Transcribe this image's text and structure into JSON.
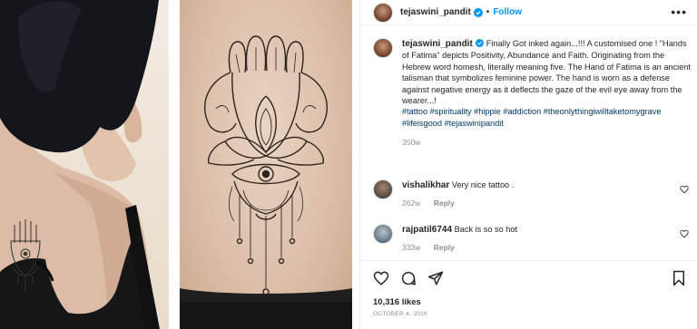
{
  "post": {
    "username": "tejaswini_pandit",
    "separator": "•",
    "follow_label": "Follow",
    "more_label": "•••",
    "caption": "Finally Got inked again...!!! A customised one ! \"Hands of Fatima\" depicts Positivity, Abundance and Faith. Originating from the Hebrew word homesh, literally meaning five. The Hand of Fatima is an ancient talisman that symbolizes feminine power. The hand is worn as a defense against negative energy as it deflects the gaze of the evil eye away from the wearer...!",
    "hashtags": "#tattoo #spirituality #hippie #addiction #theonlythingiwilltaketomygrave #lifeisgood #tejaswinipandit",
    "caption_time": "350w",
    "likes": "10,316 likes",
    "date": "OCTOBER 4, 2016"
  },
  "comments": [
    {
      "username": "vishalikhar",
      "text": "Very nice tattoo .",
      "time": "262w",
      "reply_label": "Reply"
    },
    {
      "username": "rajpatil6744",
      "text": "Back is so so hot",
      "time": "333w",
      "reply_label": "Reply"
    }
  ],
  "icons": {
    "verified": "verified-badge-icon",
    "like": "heart-icon",
    "comment": "comment-icon",
    "share": "paper-plane-icon",
    "save": "bookmark-icon"
  },
  "colors": {
    "accent": "#0095f6",
    "verified": "#0095f6",
    "text": "#262626",
    "muted": "#8e8e8e",
    "hashtag": "#00376b"
  }
}
